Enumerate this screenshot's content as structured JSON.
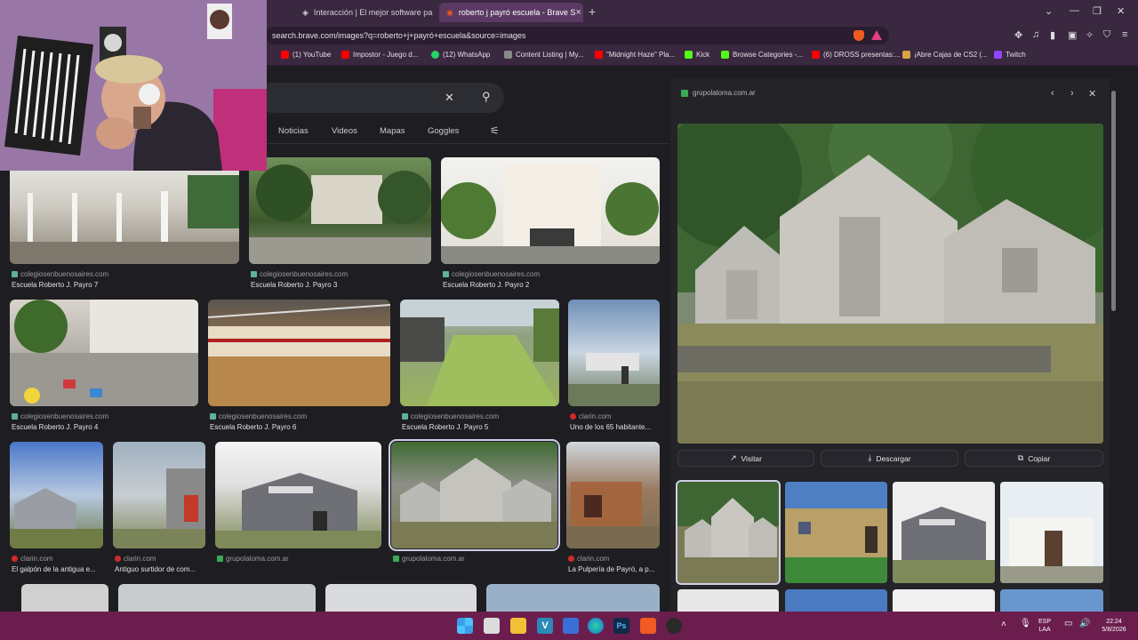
{
  "tabs": [
    {
      "label": "Interacción | El mejor software pa",
      "active": false,
      "icon": "puzzle-speaker-icon"
    },
    {
      "label": "roberto j payró escuela - Brave S",
      "active": true,
      "icon": "brave-icon"
    }
  ],
  "address": {
    "url": "search.brave.com/images?q=roberto+j+payró+escuela&source=images"
  },
  "bookmarks": [
    {
      "label": "(1) YouTube",
      "color": "#ff0000"
    },
    {
      "label": "Impostor - Juego d...",
      "color": "#ff0000"
    },
    {
      "label": "(12) WhatsApp",
      "color": "#25d366"
    },
    {
      "label": "Content Listing | My...",
      "color": "#bbbbbb"
    },
    {
      "label": "\"Midnight Haze\" Pla...",
      "color": "#ff0000"
    },
    {
      "label": "Kick",
      "color": "#53fc18"
    },
    {
      "label": "Browse Categories -...",
      "color": "#53fc18"
    },
    {
      "label": "(6) DROSS presentas:...",
      "color": "#ff0000"
    },
    {
      "label": "¡Abre Cajas de CS2 (...",
      "color": "#d9a441"
    },
    {
      "label": "Twitch",
      "color": "#9146ff"
    }
  ],
  "nav": {
    "tabs": [
      "Noticias",
      "Videos",
      "Mapas",
      "Goggles"
    ]
  },
  "results": [
    {
      "source": "colegiosenbuenosaires.com",
      "caption": "Escuela Roberto J. Payro 7"
    },
    {
      "source": "colegiosenbuenosaires.com",
      "caption": "Escuela Roberto J. Payro 3"
    },
    {
      "source": "colegiosenbuenosaires.com",
      "caption": "Escuela Roberto J. Payro 2"
    },
    {
      "source": "colegiosenbuenosaires.com",
      "caption": "Escuela Roberto J. Payro 4"
    },
    {
      "source": "colegiosenbuenosaires.com",
      "caption": "Escuela Roberto J. Payro 6"
    },
    {
      "source": "colegiosenbuenosaires.com",
      "caption": "Escuela Roberto J. Payro 5"
    },
    {
      "source": "clarin.com",
      "caption": "Uno de los 65 habitante..."
    },
    {
      "source": "clarin.com",
      "caption": "El galpón de la antigua e..."
    },
    {
      "source": "clarin.com",
      "caption": "Antiguo surtidor de com..."
    },
    {
      "source": "grupolaloma.com.ar",
      "caption": ""
    },
    {
      "source": "grupolaloma.com.ar",
      "caption": ""
    },
    {
      "source": "clarin.com",
      "caption": "La Pulpería de Payró, a p..."
    }
  ],
  "panel": {
    "source": "grupolaloma.com.ar",
    "visit_label": "Visitar",
    "download_label": "Descargar",
    "copy_label": "Copiar"
  },
  "taskbar": {
    "lang_top": "ESP",
    "lang_bottom": "LAA",
    "time": "22:24",
    "date": "5/8/2026"
  }
}
